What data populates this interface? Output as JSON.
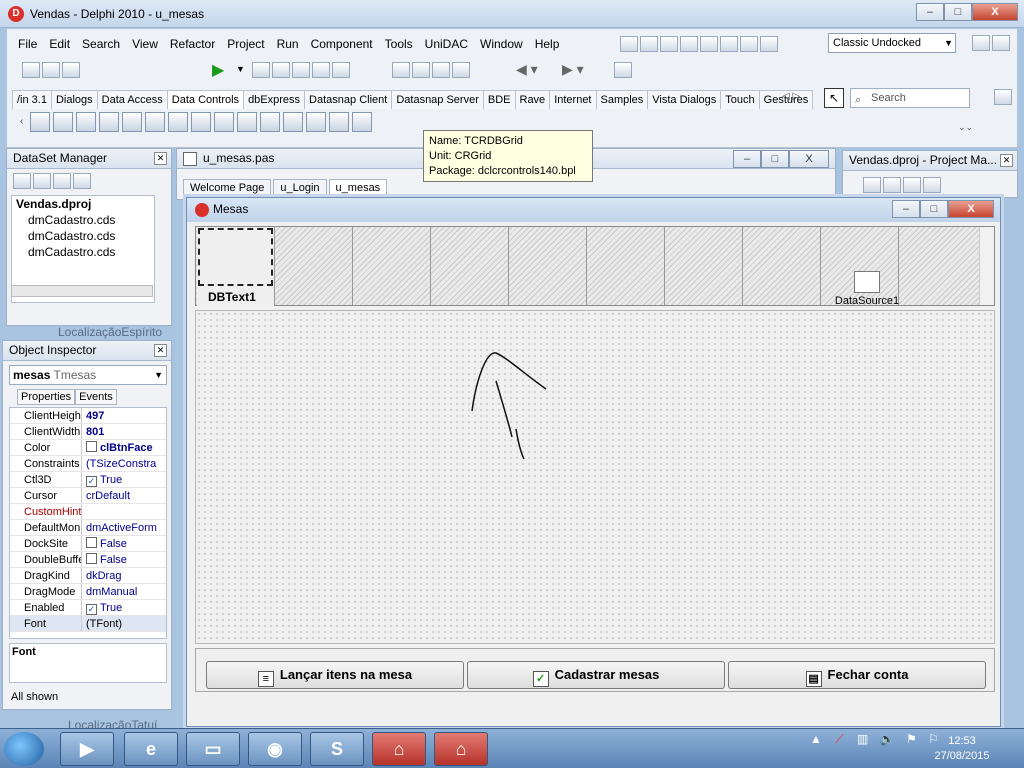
{
  "window": {
    "title": "Vendas - Delphi 2010 - u_mesas",
    "minimize": "–",
    "maximize": "□",
    "close": "X"
  },
  "menu": [
    "File",
    "Edit",
    "Search",
    "View",
    "Refactor",
    "Project",
    "Run",
    "Component",
    "Tools",
    "UniDAC",
    "Window",
    "Help"
  ],
  "layout_select": {
    "value": "Classic Undocked"
  },
  "palette_tabs": [
    "/in 3.1",
    "Dialogs",
    "Data Access",
    "Data Controls",
    "dbExpress",
    "Datasnap Client",
    "Datasnap Server",
    "BDE",
    "Rave",
    "Internet",
    "Samples",
    "Vista Dialogs",
    "Touch",
    "Gestures"
  ],
  "palette_active": "Data Controls",
  "palette_search": "Search",
  "tooltip": {
    "name": "Name: TCRDBGrid",
    "unit": "Unit: CRGrid",
    "package": "Package: dclcrcontrols140.bpl"
  },
  "dataset_manager": {
    "title": "DataSet Manager",
    "items": [
      "Vendas.dproj",
      "dmCadastro.cds",
      "dmCadastro.cds",
      "dmCadastro.cds"
    ]
  },
  "behind_text_1": "LocalizaçãoEspírito",
  "behind_text_2": "LocalizaçãoTatuí",
  "object_inspector": {
    "title": "Object Inspector",
    "selected_name": "mesas",
    "selected_type": "Tmesas",
    "tabs": [
      "Properties",
      "Events"
    ],
    "properties": [
      {
        "name": "ClientHeight",
        "value": "497"
      },
      {
        "name": "ClientWidth",
        "value": "801"
      },
      {
        "name": "Color",
        "value": "clBtnFace"
      },
      {
        "name": "Constraints",
        "value": "(TSizeConstra"
      },
      {
        "name": "Ctl3D",
        "value": "True"
      },
      {
        "name": "Cursor",
        "value": "crDefault"
      },
      {
        "name": "CustomHint",
        "value": ""
      },
      {
        "name": "DefaultMoni",
        "value": "dmActiveForm"
      },
      {
        "name": "DockSite",
        "value": "False"
      },
      {
        "name": "DoubleBuffe",
        "value": "False"
      },
      {
        "name": "DragKind",
        "value": "dkDrag"
      },
      {
        "name": "DragMode",
        "value": "dmManual"
      },
      {
        "name": "Enabled",
        "value": "True"
      },
      {
        "name": "Font",
        "value": "(TFont)"
      }
    ],
    "description": "Font",
    "footer": "All shown"
  },
  "editor": {
    "title": "u_mesas.pas",
    "tabs": [
      "Welcome Page",
      "u_Login",
      "u_mesas"
    ]
  },
  "project_manager": {
    "title": "Vendas.dproj - Project Ma..."
  },
  "form": {
    "title": "Mesas",
    "dbtext_label": "DBText1",
    "datasource_label": "DataSource1",
    "buttons": [
      "Lançar itens na mesa",
      "Cadastrar mesas",
      "Fechar conta"
    ]
  },
  "clock": {
    "time": "12:53",
    "date": "27/08/2015"
  }
}
